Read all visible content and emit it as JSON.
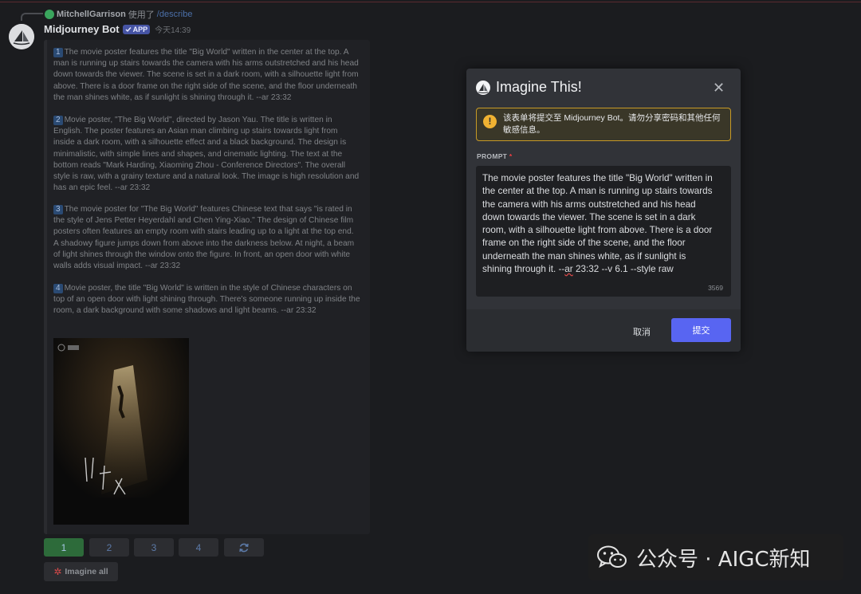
{
  "reply": {
    "user": "MitchellGarrison",
    "used": "使用了",
    "command": "/describe"
  },
  "message": {
    "bot_name": "Midjourney Bot",
    "badge": "APP",
    "time": "今天14:39"
  },
  "descriptions": [
    {
      "num": "1",
      "text": "The movie poster features the title \"Big World\" written in the center at the top. A man is running up stairs towards the camera with his arms outstretched and his head down towards the viewer. The scene is set in a dark room, with a silhouette light from above. There is a door frame on the right side of the scene, and the floor underneath the man shines white, as if sunlight is shining through it. --ar 23:32"
    },
    {
      "num": "2",
      "text": "Movie poster, \"The Big World\", directed by Jason Yau. The title is written in English. The poster features an Asian man climbing up stairs towards light from inside a dark room, with a silhouette effect and a black background. The design is minimalistic, with simple lines and shapes, and cinematic lighting. The text at the bottom reads \"Mark Harding, Xiaoming Zhou - Conference Directors\". The overall style is raw, with a grainy texture and a natural look. The image is high resolution and has an epic feel. --ar 23:32"
    },
    {
      "num": "3",
      "text": "The movie poster for \"The Big World\" features Chinese text that says \"is rated in the style of Jens Petter Heyerdahl and Chen Ying-Xiao.\" The design of Chinese film posters often features an empty room with stairs leading up to a light at the top end. A shadowy figure jumps down from above into the darkness below. At night, a beam of light shines through the window onto the figure. In front, an open door with white walls adds visual impact. --ar 23:32"
    },
    {
      "num": "4",
      "text": "Movie poster, the title \"Big World\" is written in the style of Chinese characters on top of an open door with light shining through. There's someone running up inside the room, a dark background with some shadows and light beams. --ar 23:32"
    }
  ],
  "buttons": [
    "1",
    "2",
    "3",
    "4"
  ],
  "refresh_icon": "refresh-icon",
  "imagine_all": "Imagine all",
  "modal": {
    "title": "Imagine This!",
    "close": "✕",
    "warning_icon": "!",
    "warning": "该表单将提交至 Midjourney Bot。请勿分享密码和其他任何敏感信息。",
    "label": "PROMPT",
    "required": "*",
    "prompt_main": "The movie poster features the title \"Big World\" written in the center at the top. A man is running up stairs towards the camera with his arms outstretched and his head down towards the viewer. The scene is set in a dark room, with a silhouette light from above. There is a door frame on the right side of the scene, and the floor underneath the man shines white, as if sunlight is shining through it. --",
    "prompt_squiggle": "ar",
    "prompt_tail": " 23:32 --v 6.1 --style raw",
    "char_count": "3569",
    "cancel": "取消",
    "submit": "提交"
  },
  "watermark": "公众号 · AIGC新知"
}
